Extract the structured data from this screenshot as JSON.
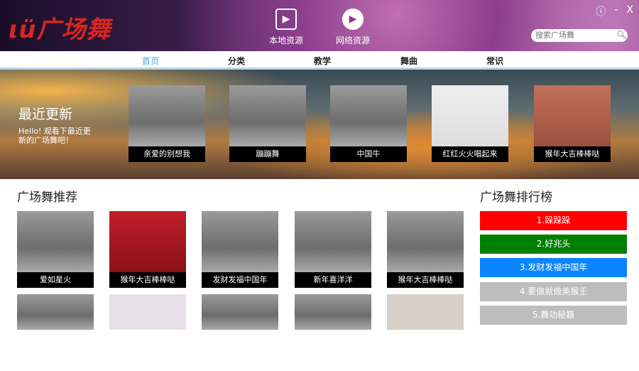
{
  "header": {
    "logo": "ιü广场舞",
    "nav": [
      {
        "label": "本地资源",
        "icon": "film-icon"
      },
      {
        "label": "网络资源",
        "icon": "play-disc-icon"
      }
    ],
    "window": {
      "info": "ⓘ",
      "minimize": "-",
      "close": "X"
    },
    "search_placeholder": "搜索广场舞"
  },
  "tabs": [
    "首页",
    "分类",
    "教学",
    "舞曲",
    "常识"
  ],
  "banner": {
    "title": "最近更新",
    "subtitle": "Hello! 观看下最近更新的广场舞吧！",
    "items": [
      "亲爱的别想我",
      "蹦蹦舞",
      "中国牛",
      "红红火火唱起来",
      "猴年大吉棒棒哒"
    ]
  },
  "recommend": {
    "title": "广场舞推荐",
    "items": [
      "爱如星火",
      "猴年大吉棒棒哒",
      "发财发福中国年",
      "新年喜洋洋",
      "猴年大吉棒棒哒"
    ]
  },
  "ranking": {
    "title": "广场舞排行榜",
    "items": [
      {
        "label": "1.跺跺跺",
        "color": "#ff0000"
      },
      {
        "label": "2.好兆头",
        "color": "#008000"
      },
      {
        "label": "3.发财发福中国年",
        "color": "#0a84ff"
      },
      {
        "label": "4.要做就做美猴王",
        "color": "#bdbdbd"
      },
      {
        "label": "5.舞功秘籍",
        "color": "#bdbdbd"
      }
    ]
  }
}
